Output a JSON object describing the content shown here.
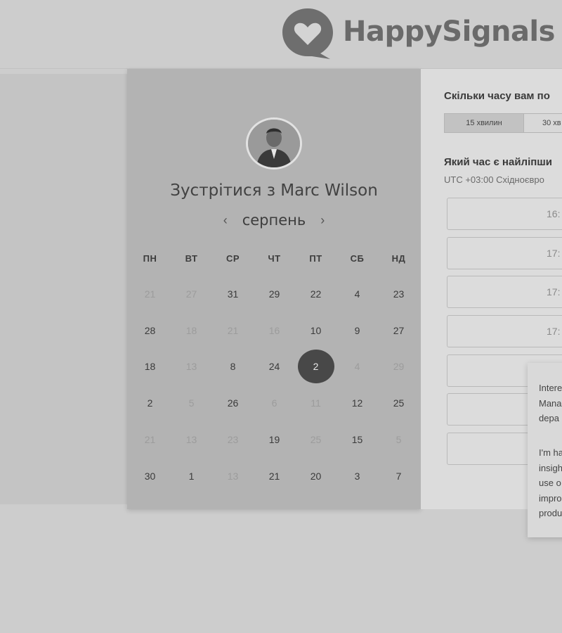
{
  "brand": {
    "name": "HappySignals",
    "logo_icon": "heart-speech-bubble-icon"
  },
  "calendar": {
    "title": "Зустрітися з Marc Wilson",
    "month": "серпень",
    "prev_icon": "chevron-left-icon",
    "next_icon": "chevron-right-icon",
    "weekdays": [
      "ПН",
      "ВТ",
      "СР",
      "ЧТ",
      "ПТ",
      "СБ",
      "НД"
    ],
    "days": [
      {
        "label": "21",
        "muted": true
      },
      {
        "label": "27",
        "muted": true
      },
      {
        "label": "31",
        "muted": false
      },
      {
        "label": "29",
        "muted": false
      },
      {
        "label": "22",
        "muted": false
      },
      {
        "label": "4",
        "muted": false
      },
      {
        "label": "23",
        "muted": false
      },
      {
        "label": "28",
        "muted": false
      },
      {
        "label": "18",
        "muted": true
      },
      {
        "label": "21",
        "muted": true
      },
      {
        "label": "16",
        "muted": true
      },
      {
        "label": "10",
        "muted": false
      },
      {
        "label": "9",
        "muted": false
      },
      {
        "label": "27",
        "muted": false
      },
      {
        "label": "18",
        "muted": false
      },
      {
        "label": "13",
        "muted": true
      },
      {
        "label": "8",
        "muted": false
      },
      {
        "label": "24",
        "muted": false
      },
      {
        "label": "2",
        "muted": false,
        "selected": true
      },
      {
        "label": "4",
        "muted": true
      },
      {
        "label": "29",
        "muted": true
      },
      {
        "label": "2",
        "muted": false
      },
      {
        "label": "5",
        "muted": true
      },
      {
        "label": "26",
        "muted": false
      },
      {
        "label": "6",
        "muted": true
      },
      {
        "label": "11",
        "muted": true
      },
      {
        "label": "12",
        "muted": false
      },
      {
        "label": "25",
        "muted": false
      },
      {
        "label": "21",
        "muted": true
      },
      {
        "label": "13",
        "muted": true
      },
      {
        "label": "23",
        "muted": true
      },
      {
        "label": "19",
        "muted": false
      },
      {
        "label": "25",
        "muted": true
      },
      {
        "label": "15",
        "muted": false
      },
      {
        "label": "5",
        "muted": true
      },
      {
        "label": "30",
        "muted": false
      },
      {
        "label": "1",
        "muted": false
      },
      {
        "label": "13",
        "muted": true
      },
      {
        "label": "21",
        "muted": false
      },
      {
        "label": "20",
        "muted": false
      },
      {
        "label": "3",
        "muted": false
      },
      {
        "label": "7",
        "muted": false
      }
    ]
  },
  "scheduler": {
    "duration_question": "Скільки часу вам по",
    "durations": [
      "15 хвилин",
      "30 хв"
    ],
    "time_question": "Який час є найліпши",
    "timezone": "UTC +03:00 Східноєвро",
    "slots": [
      "16:",
      "17:",
      "17:",
      "17:",
      "",
      "",
      ""
    ]
  },
  "popup": {
    "lines_1": [
      "Intere",
      "Mana",
      "depa"
    ],
    "lines_2": [
      "I'm ha",
      "insigh",
      "use o",
      "impro",
      "produ"
    ]
  }
}
